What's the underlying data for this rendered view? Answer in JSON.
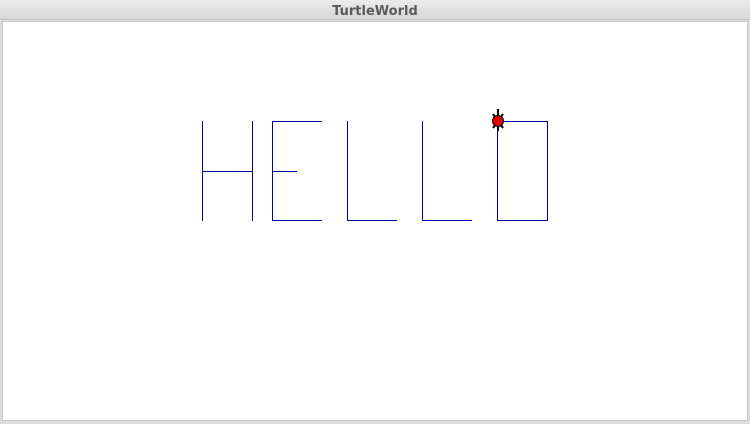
{
  "window": {
    "title": "TurtleWorld"
  },
  "canvas": {
    "background": "#ffffff",
    "stroke_color": "#0000aa"
  },
  "turtle": {
    "icon": "turtle-icon",
    "body_color": "#e00000",
    "outline_color": "#000000",
    "heading": "up"
  }
}
